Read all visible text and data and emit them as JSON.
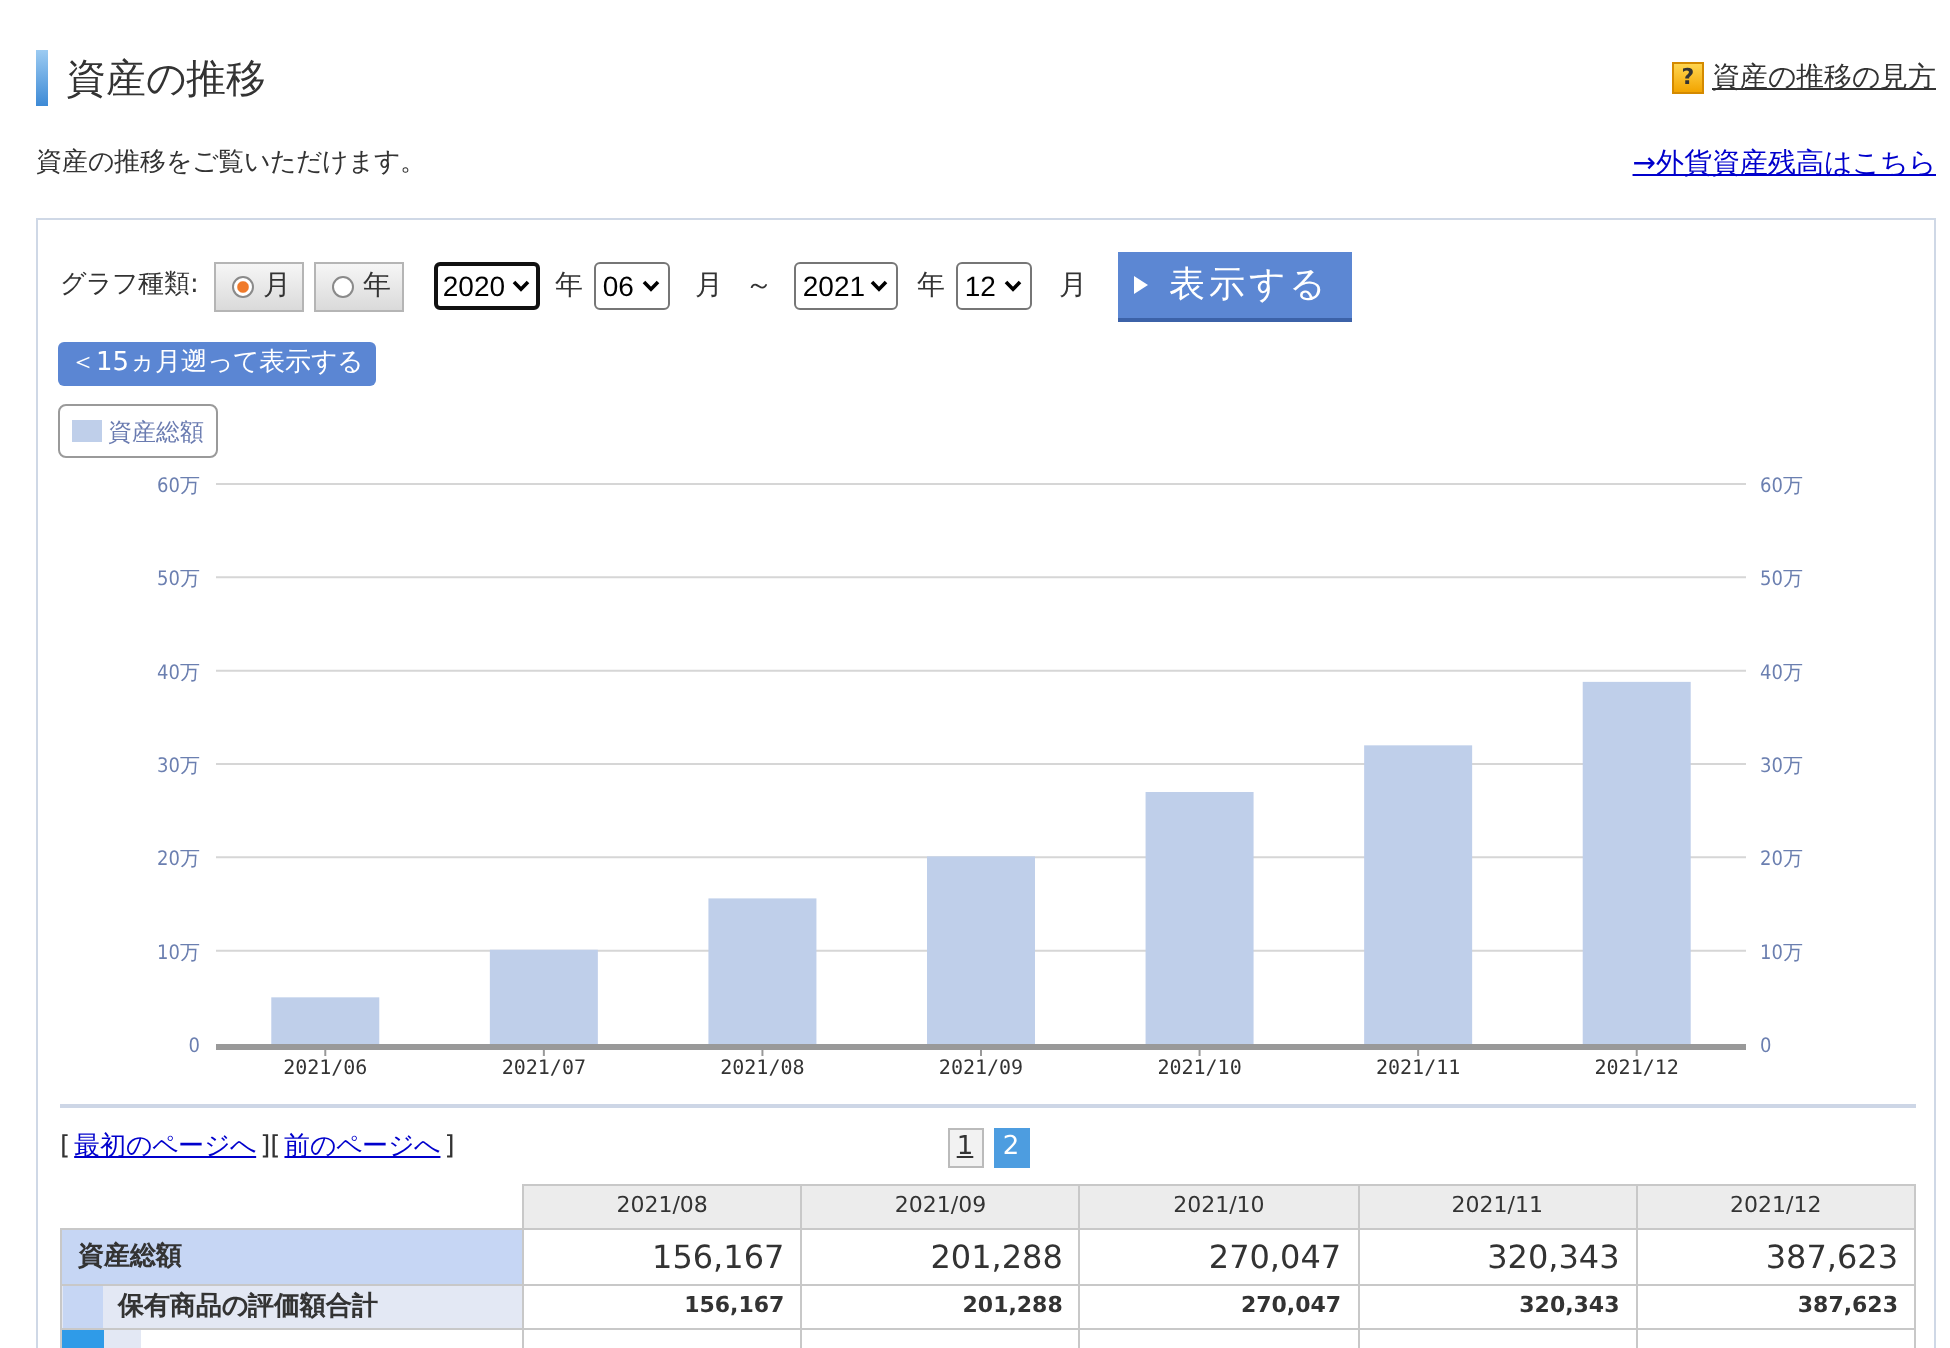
{
  "header": {
    "title": "資産の推移",
    "help_icon": "?",
    "help_link": "資産の推移の見方"
  },
  "intro": {
    "text": "資産の推移をご覧いただけます。",
    "link": "→外貨資産残高はこちら"
  },
  "controls": {
    "graph_type_label": "グラフ種類:",
    "graph_types": [
      {
        "label": "月",
        "selected": true
      },
      {
        "label": "年",
        "selected": false
      }
    ],
    "from": {
      "year": "2020",
      "year_focused": true,
      "year_unit": "年",
      "month": "06",
      "month_unit": "月"
    },
    "separator": "～",
    "to": {
      "year": "2021",
      "year_focused": false,
      "year_unit": "年",
      "month": "12",
      "month_unit": "月"
    },
    "submit_button": "表示する",
    "back_button": "＜15ヵ月遡って表示する"
  },
  "chart": {
    "chart_data": {
      "type": "bar",
      "categories": [
        "2021/06",
        "2021/07",
        "2021/08",
        "2021/09",
        "2021/10",
        "2021/11",
        "2021/12"
      ],
      "series": [
        {
          "name": "資産総額",
          "color": "#bfcfea",
          "values": [
            5.0,
            10.1,
            15.6,
            20.1,
            27.0,
            32.0,
            38.8
          ]
        }
      ],
      "ylim": [
        0,
        60
      ],
      "yticks": [
        {
          "value": 0,
          "label": "0"
        },
        {
          "value": 10,
          "label": "10万"
        },
        {
          "value": 20,
          "label": "20万"
        },
        {
          "value": 30,
          "label": "30万"
        },
        {
          "value": 40,
          "label": "40万"
        },
        {
          "value": 50,
          "label": "50万"
        },
        {
          "value": 60,
          "label": "60万"
        }
      ],
      "grid": true
    }
  },
  "pager": {
    "links": [
      {
        "open": "[",
        "label": "最初のページへ",
        "close": "]"
      },
      {
        "open": "[",
        "label": "前のページへ",
        "close": "]"
      }
    ],
    "pages": [
      {
        "label": "1",
        "selected": false
      },
      {
        "label": "2",
        "selected": true
      }
    ]
  },
  "table": {
    "columns": [
      "2021/08",
      "2021/09",
      "2021/10",
      "2021/11",
      "2021/12"
    ],
    "rows": [
      {
        "kind": "total",
        "label": "資産総額",
        "values": [
          "156,167",
          "201,288",
          "270,047",
          "320,343",
          "387,623"
        ]
      },
      {
        "kind": "subtotal",
        "label": "保有商品の評価額合計",
        "values": [
          "156,167",
          "201,288",
          "270,047",
          "320,343",
          "387,623"
        ]
      },
      {
        "kind": "item",
        "color": "#2f9be8"
      }
    ]
  }
}
